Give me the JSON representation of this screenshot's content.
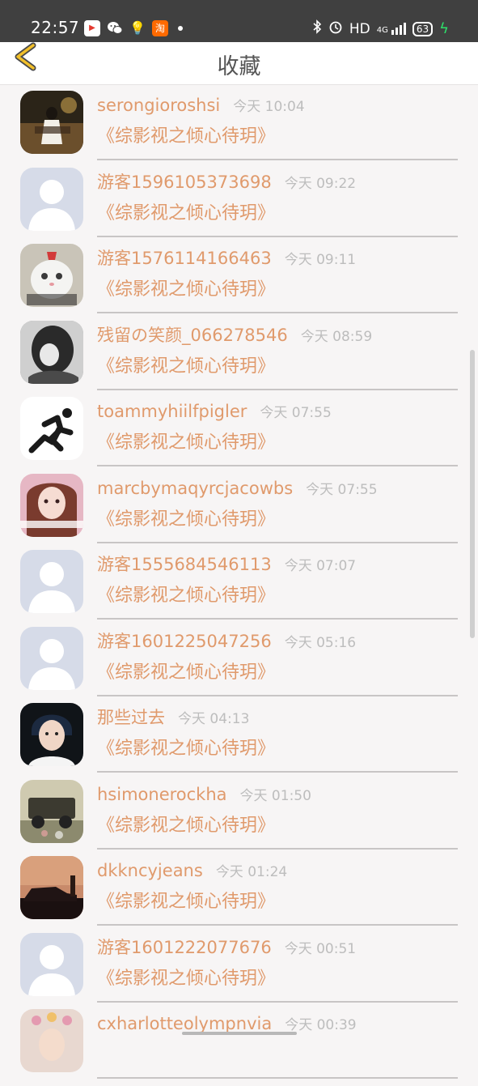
{
  "status_bar": {
    "time": "22:57",
    "hd_label": "HD",
    "network_label": "4G",
    "battery": "63",
    "app_icons": [
      "youku-icon",
      "wechat-icon",
      "bulb-icon",
      "taobao-icon",
      "dot-icon"
    ],
    "taobao_glyph": "淘"
  },
  "header": {
    "title": "收藏",
    "back_icon": "chevron-left-icon"
  },
  "colors": {
    "accent": "#e09a6c",
    "time_text": "#bdbdbd",
    "status_bar_bg": "#404040",
    "page_bg": "#f7f5f5"
  },
  "items": [
    {
      "user": "serongioroshsi",
      "time": "今天 10:04",
      "book": "《综影视之倾心待玥》",
      "avatar": "photo-girl-dusk"
    },
    {
      "user": "游客1596105373698",
      "time": "今天 09:22",
      "book": "《综影视之倾心待玥》",
      "avatar": "default-avatar"
    },
    {
      "user": "游客1576114166463",
      "time": "今天 09:11",
      "book": "《综影视之倾心待玥》",
      "avatar": "photo-white-cat"
    },
    {
      "user": "残留の笑颜_066278546",
      "time": "今天 08:59",
      "book": "《综影视之倾心待玥》",
      "avatar": "photo-bw-girl"
    },
    {
      "user": "toammyhiilfpigler",
      "time": "今天 07:55",
      "book": "《综影视之倾心待玥》",
      "avatar": "runner-logo"
    },
    {
      "user": "marcbymaqyrcjacowbs",
      "time": "今天 07:55",
      "book": "《综影视之倾心待玥》",
      "avatar": "photo-pink-girl"
    },
    {
      "user": "游客1555684546113",
      "time": "今天 07:07",
      "book": "《综影视之倾心待玥》",
      "avatar": "default-avatar"
    },
    {
      "user": "游客1601225047256",
      "time": "今天 05:16",
      "book": "《综影视之倾心待玥》",
      "avatar": "default-avatar"
    },
    {
      "user": "那些过去",
      "time": "今天 04:13",
      "book": "《综影视之倾心待玥》",
      "avatar": "photo-boy"
    },
    {
      "user": "hsimonerockha",
      "time": "今天 01:50",
      "book": "《综影视之倾心待玥》",
      "avatar": "photo-jeep"
    },
    {
      "user": "dkkncyjeans",
      "time": "今天 01:24",
      "book": "《综影视之倾心待玥》",
      "avatar": "photo-sunset-car"
    },
    {
      "user": "游客1601222077676",
      "time": "今天 00:51",
      "book": "《综影视之倾心待玥》",
      "avatar": "default-avatar"
    },
    {
      "user": "cxharlotteolympnvia",
      "time": "今天 00:39",
      "book": "",
      "avatar": "photo-flower-girl"
    }
  ]
}
